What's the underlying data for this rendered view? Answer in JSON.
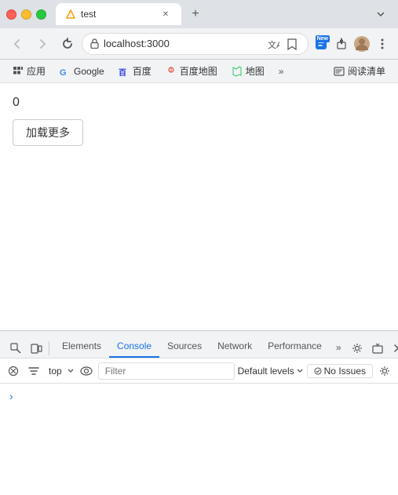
{
  "window": {
    "title": "test"
  },
  "browser": {
    "back_disabled": true,
    "forward_disabled": true,
    "url": "localhost:3000",
    "tab_title": "test"
  },
  "bookmarks": {
    "items": [
      {
        "label": "应用",
        "icon": "grid"
      },
      {
        "label": "Google",
        "icon": "google"
      },
      {
        "label": "百度",
        "icon": "baidu"
      },
      {
        "label": "百度地图",
        "icon": "baidu-map"
      },
      {
        "label": "地图",
        "icon": "map"
      }
    ],
    "more_label": "»",
    "reader_label": "阅读清单"
  },
  "page": {
    "counter": "0",
    "load_more_button": "加载更多"
  },
  "devtools": {
    "tabs": [
      {
        "label": "Elements",
        "active": false
      },
      {
        "label": "Console",
        "active": true
      },
      {
        "label": "Sources",
        "active": false
      },
      {
        "label": "Network",
        "active": false
      },
      {
        "label": "Performance",
        "active": false
      }
    ],
    "more_label": "»",
    "console": {
      "top_label": "top",
      "filter_placeholder": "Filter",
      "levels_label": "Default levels",
      "no_issues_label": "No Issues"
    }
  }
}
